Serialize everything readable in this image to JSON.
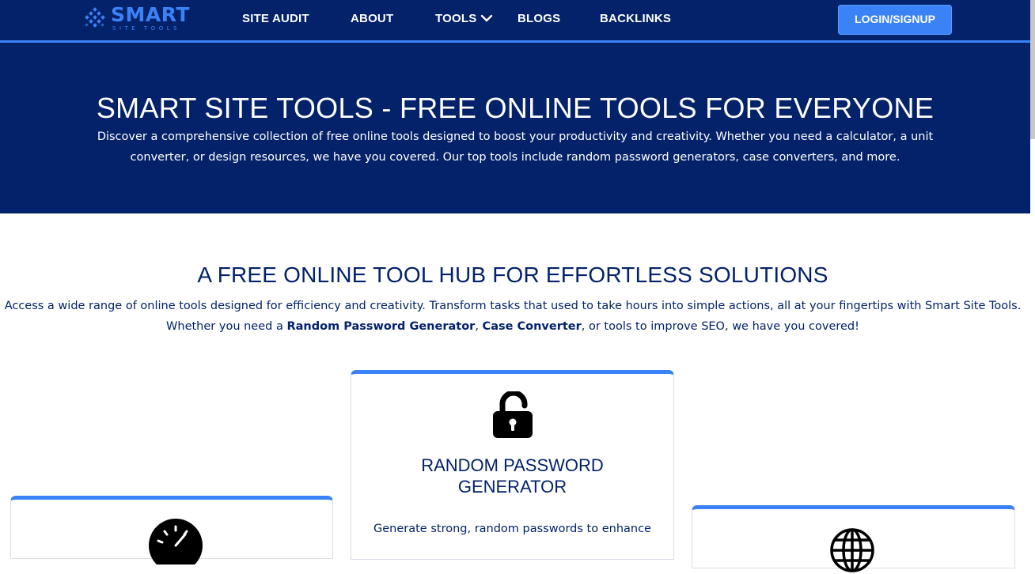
{
  "brand": {
    "name": "SMART",
    "sub": "SITE TOOLS",
    "primary_color": "#03226a",
    "accent_color": "#3b82f6"
  },
  "nav": {
    "items": [
      {
        "label": "SITE AUDIT"
      },
      {
        "label": "ABOUT"
      },
      {
        "label": "TOOLS",
        "has_dropdown": true,
        "icon": "chevron-down-icon"
      },
      {
        "label": "BLOGS"
      },
      {
        "label": "BACKLINKS"
      }
    ],
    "login_label": "LOGIN/SIGNUP"
  },
  "hero": {
    "title": "SMART SITE TOOLS - FREE ONLINE TOOLS FOR EVERYONE",
    "description": "Discover a comprehensive collection of free online tools designed to boost your productivity and creativity. Whether you need a calculator, a unit converter, or design resources, we have you covered. Our top tools include random password generators, case converters, and more."
  },
  "section": {
    "title": "A FREE ONLINE TOOL HUB FOR EFFORTLESS SOLUTIONS",
    "desc_line1": "Access a wide range of online tools designed for efficiency and creativity. Transform tasks that used to take hours into simple actions, all at your fingertips with Smart Site Tools.",
    "desc_prefix": "Whether you need a ",
    "desc_bold1": "Random Password Generator",
    "desc_sep": ", ",
    "desc_bold2": "Case Converter",
    "desc_suffix": ", or tools to improve SEO, we have you covered!"
  },
  "cards": [
    {
      "title_line1": "RANDOM PASSWORD",
      "title_line2": "GENERATOR",
      "description": "Generate strong, random passwords to enhance",
      "icon": "unlocked-padlock-icon"
    },
    {
      "icon": "speed-gauge-icon"
    },
    {
      "icon": "globe-icon"
    }
  ]
}
